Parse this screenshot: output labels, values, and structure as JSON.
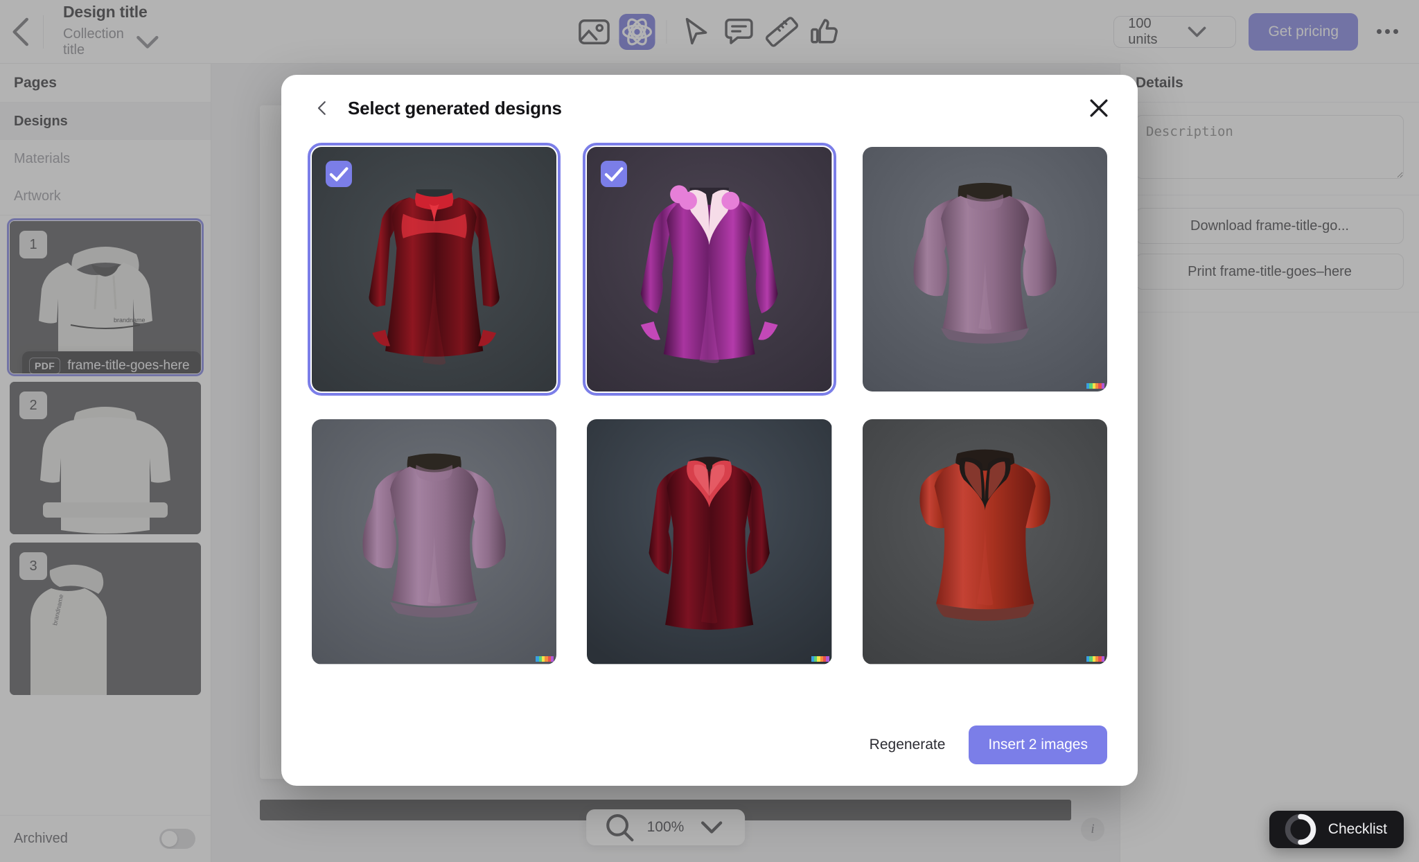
{
  "header": {
    "back_icon": "chevron-left-icon",
    "design_title": "Design title",
    "collection_title": "Collection title",
    "collection_chevron": "chevron-down-icon",
    "tools": [
      {
        "name": "image-icon",
        "label": "Image",
        "active": false
      },
      {
        "name": "ai-atom-icon",
        "label": "AI generate",
        "active": true
      },
      {
        "name": "cursor-icon",
        "label": "Select",
        "active": false
      },
      {
        "name": "comment-icon",
        "label": "Comment",
        "active": false
      },
      {
        "name": "ruler-icon",
        "label": "Measure",
        "active": false
      },
      {
        "name": "thumbs-up-icon",
        "label": "Approve",
        "active": false
      }
    ],
    "units_value": "100 units",
    "units_chevron": "chevron-down-icon",
    "get_pricing_label": "Get pricing",
    "more_icon": "more-horizontal-icon"
  },
  "sidebar": {
    "section_title": "Pages",
    "items": [
      {
        "label": "Designs",
        "active": true
      },
      {
        "label": "Materials",
        "active": false
      },
      {
        "label": "Artwork",
        "active": false
      }
    ],
    "thumbnails": [
      {
        "number": "1",
        "selected": true,
        "view": "front",
        "tooltip": {
          "chip": "PDF",
          "label": "frame-title-goes-here"
        }
      },
      {
        "number": "2",
        "selected": false,
        "view": "back"
      },
      {
        "number": "3",
        "selected": false,
        "view": "side"
      }
    ],
    "archived_label": "Archived",
    "archived_on": false
  },
  "right_panel": {
    "title": "Details",
    "description_placeholder": "Description",
    "description_value": "",
    "download_label": "Download frame-title-go...",
    "print_label": "Print frame-title-goes–here"
  },
  "canvas": {
    "zoom_icon": "magnifier-icon",
    "zoom_value": "100%",
    "zoom_chevron": "chevron-down-icon",
    "info_icon": "info-icon"
  },
  "checklist": {
    "icon": "progress-ring-icon",
    "label": "Checklist"
  },
  "modal": {
    "back_icon": "chevron-left-icon",
    "title": "Select generated designs",
    "close_icon": "close-icon",
    "regenerate_label": "Regenerate",
    "insert_label": "Insert 2 images",
    "selected_count": 2,
    "designs": [
      {
        "id": 1,
        "selected": true,
        "style": "red-velvet-tie-collar",
        "bg": "#3c4043",
        "garment": "#6e1118",
        "accent": "#e8343f",
        "watermark": false
      },
      {
        "id": 2,
        "selected": true,
        "style": "magenta-velvet-v-neck",
        "bg": "#3e3a44",
        "garment": "#8e2a86",
        "accent": "#f49ae8",
        "watermark": false
      },
      {
        "id": 3,
        "selected": false,
        "style": "mauve-puff-sleeve-peplum",
        "bg": "#5b5f66",
        "garment": "#8b6b85",
        "accent": "#a98aa4",
        "watermark": true
      },
      {
        "id": 4,
        "selected": false,
        "style": "mauve-puff-sleeve-peplum",
        "bg": "#5e6168",
        "garment": "#8d6e88",
        "accent": "#ab8da6",
        "watermark": true
      },
      {
        "id": 5,
        "selected": false,
        "style": "dark-red-v-neck-tunic",
        "bg": "#343b44",
        "garment": "#59101d",
        "accent": "#e2535f",
        "watermark": true
      },
      {
        "id": 6,
        "selected": false,
        "style": "red-flutter-sleeve-peplum",
        "bg": "#4b4b4d",
        "garment": "#b03328",
        "accent": "#d2463a",
        "watermark": true
      }
    ]
  },
  "colors": {
    "accent": "#6b6fe0",
    "accent_light": "#7b7ee8",
    "dark": "#18181b",
    "text": "#141417",
    "muted": "#8a8a91"
  }
}
